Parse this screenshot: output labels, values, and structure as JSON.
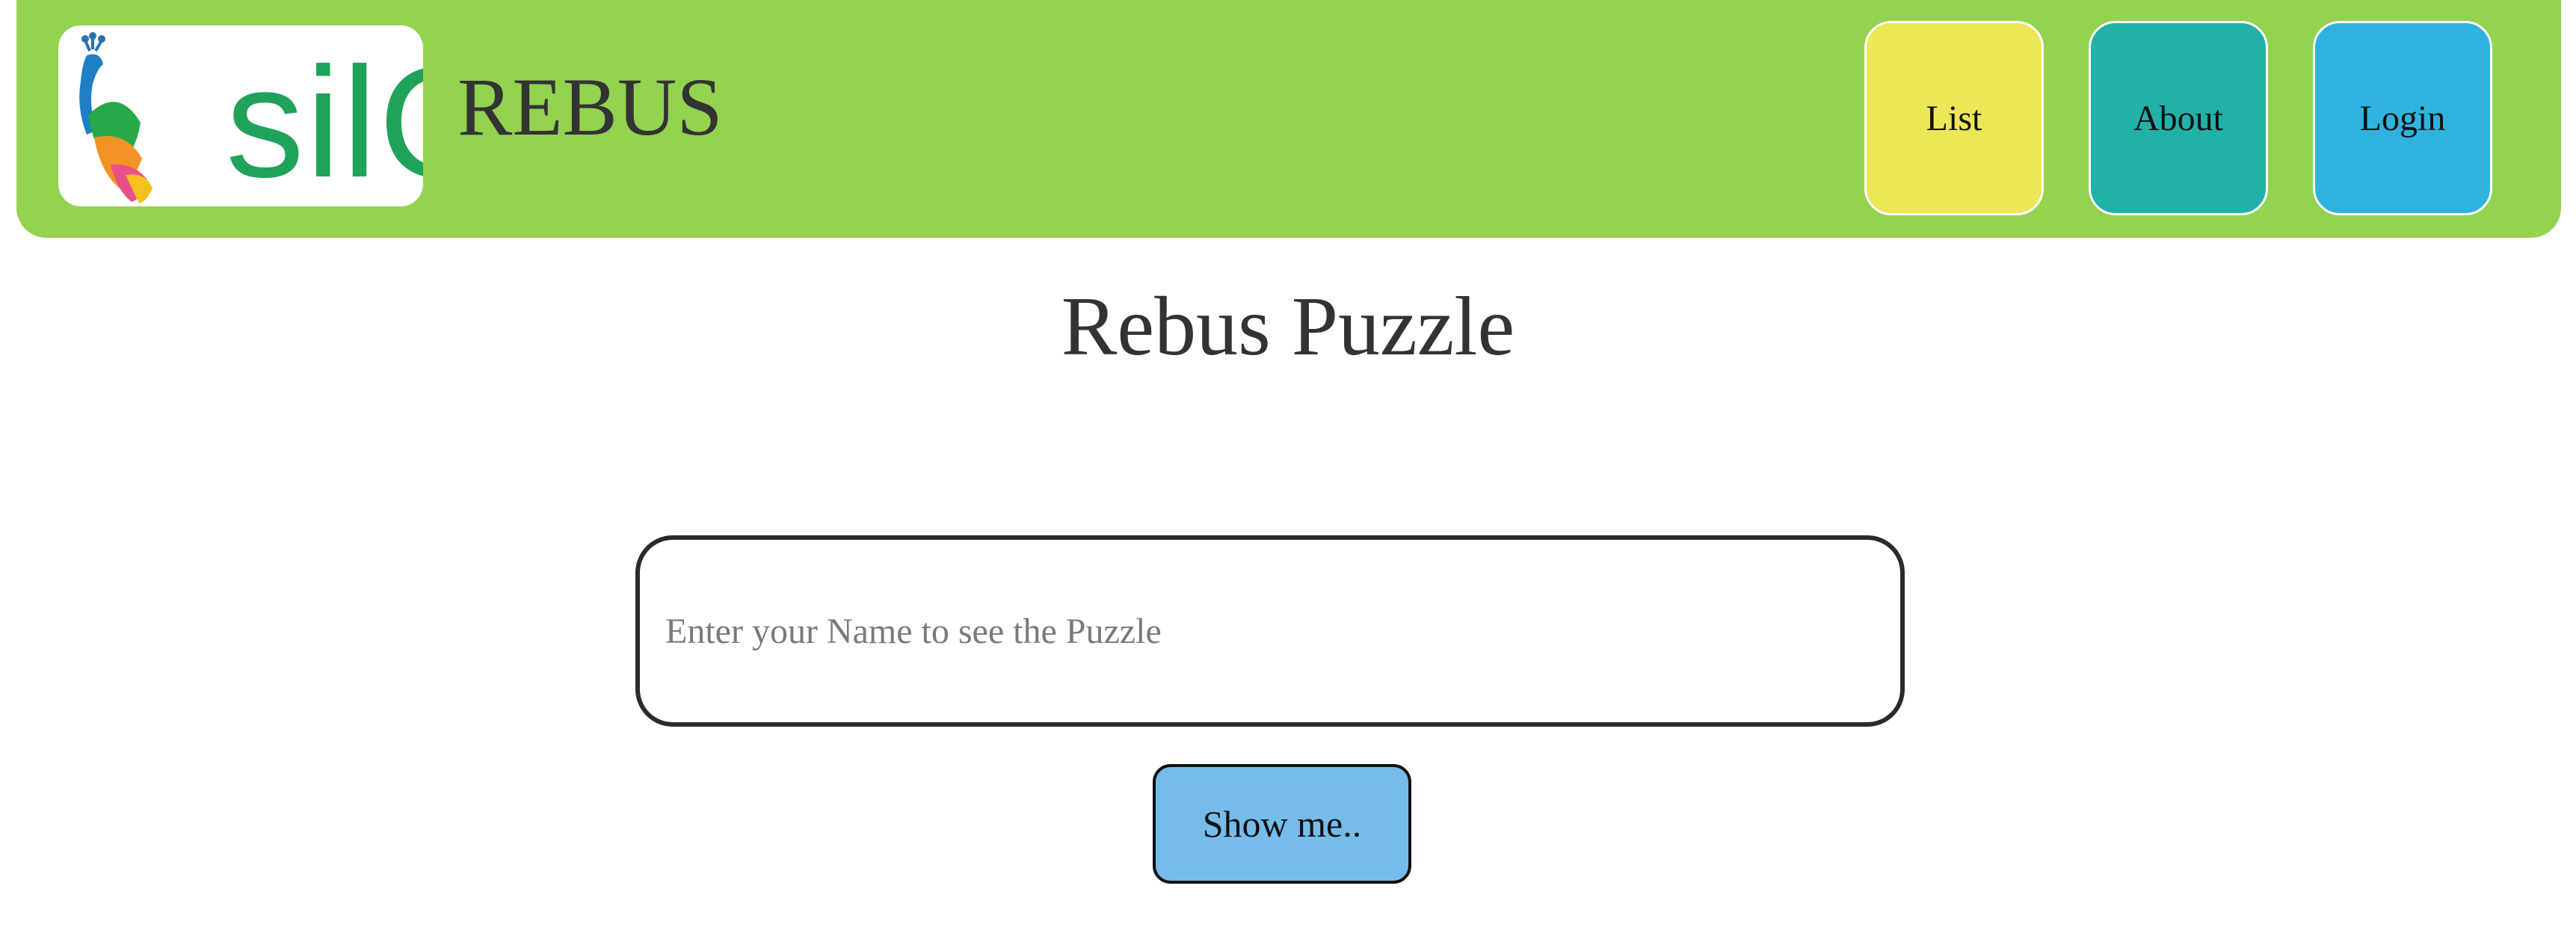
{
  "header": {
    "logo_text": "silC",
    "app_title": "REBUS",
    "nav": [
      {
        "label": "List",
        "color": "#ede656"
      },
      {
        "label": "About",
        "color": "#22b1a8"
      },
      {
        "label": "Login",
        "color": "#2fb3de"
      }
    ],
    "bar_color": "#93d350"
  },
  "main": {
    "title": "Rebus Puzzle",
    "name_input": {
      "value": "",
      "placeholder": "Enter your Name to see the Puzzle"
    },
    "submit_label": "Show me..",
    "submit_color": "#75bcea"
  }
}
